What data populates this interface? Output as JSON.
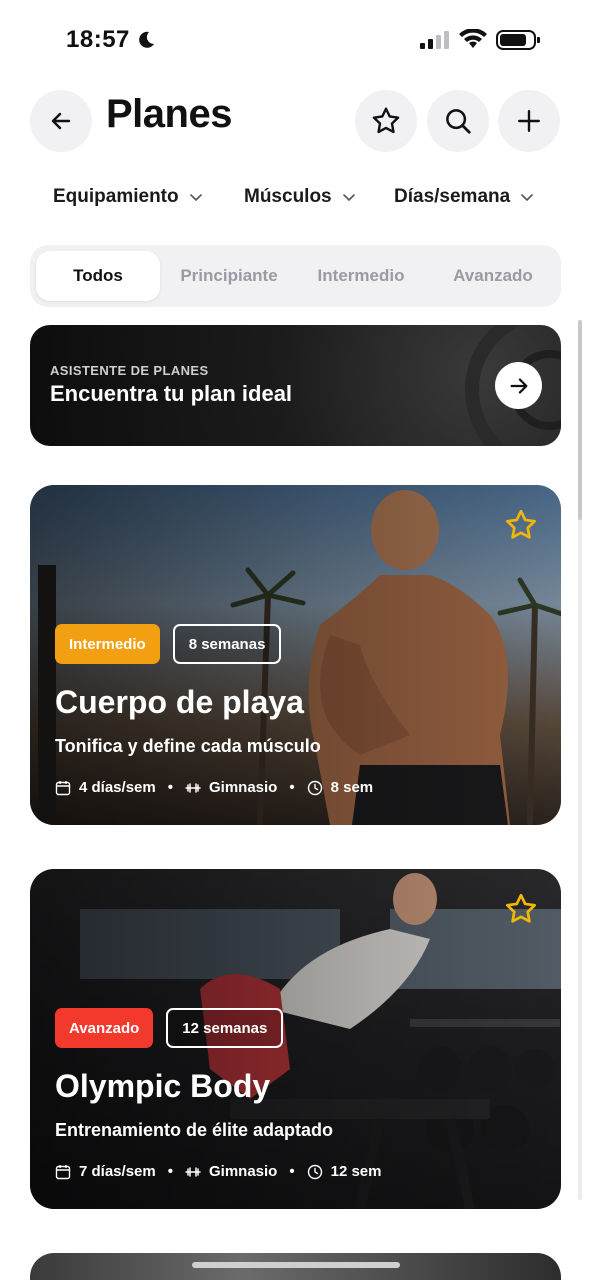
{
  "status_bar": {
    "time": "18:57"
  },
  "header": {
    "title": "Planes"
  },
  "filters": [
    {
      "label": "Equipamiento"
    },
    {
      "label": "Músculos"
    },
    {
      "label": "Días/semana"
    }
  ],
  "levels": {
    "selected": "Todos",
    "items": [
      "Todos",
      "Principiante",
      "Intermedio",
      "Avanzado"
    ]
  },
  "assistant": {
    "kicker": "ASISTENTE DE PLANES",
    "title": "Encuentra tu plan ideal"
  },
  "plans": [
    {
      "level": "Intermedio",
      "duration": "8 semanas",
      "title": "Cuerpo de playa",
      "subtitle": "Tonifica y define cada músculo",
      "days": "4 días/sem",
      "equipment": "Gimnasio",
      "weeks": "8 sem",
      "level_color": "#f2a012"
    },
    {
      "level": "Avanzado",
      "duration": "12 semanas",
      "title": "Olympic Body",
      "subtitle": "Entrenamiento de élite adaptado",
      "days": "7 días/sem",
      "equipment": "Gimnasio",
      "weeks": "12 sem",
      "level_color": "#f2392c"
    }
  ],
  "colors": {
    "star": "#f2b705",
    "accent_bg": "#f1f1f4"
  }
}
